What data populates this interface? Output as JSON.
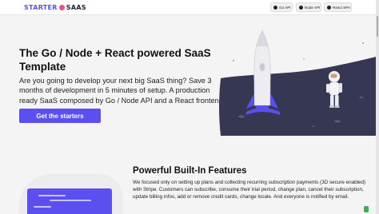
{
  "nav": {
    "logo_part1": "STARTER",
    "logo_part2": "SAAS",
    "buttons": [
      {
        "label": "Go API",
        "icon": "github-icon"
      },
      {
        "label": "Node API",
        "icon": "github-icon"
      },
      {
        "label": "React SPA",
        "icon": "github-icon"
      }
    ]
  },
  "hero": {
    "title": "The Go / Node + React powered SaaS Template",
    "description": "Are you going to develop your next big SaaS thing? Save 3 months of development in 5 minutes of setup. A production ready SaaS composed by Go / Node API and a React frontend",
    "cta_label": "Get the starters"
  },
  "features": {
    "title": "Powerful Built-In Features",
    "description": "We focused only on setting up plans and collecting recurring subscription payments (3D secure enabled) with Stripe. Customers can subscribe, consume their trial period, change plan, cancel their subscription, update billing infos, add or remove credit cards, change locale. And everyone is notified by email."
  },
  "colors": {
    "accent": "#5b4ff0",
    "logo_dot": "#ef4f8f",
    "planet": "#363753",
    "rocket_fin": "#5b4ff0",
    "background": "#f4f4f5"
  },
  "icons": {
    "rocket": "rocket-illustration",
    "astronaut": "astronaut-illustration",
    "github": "github-icon"
  }
}
